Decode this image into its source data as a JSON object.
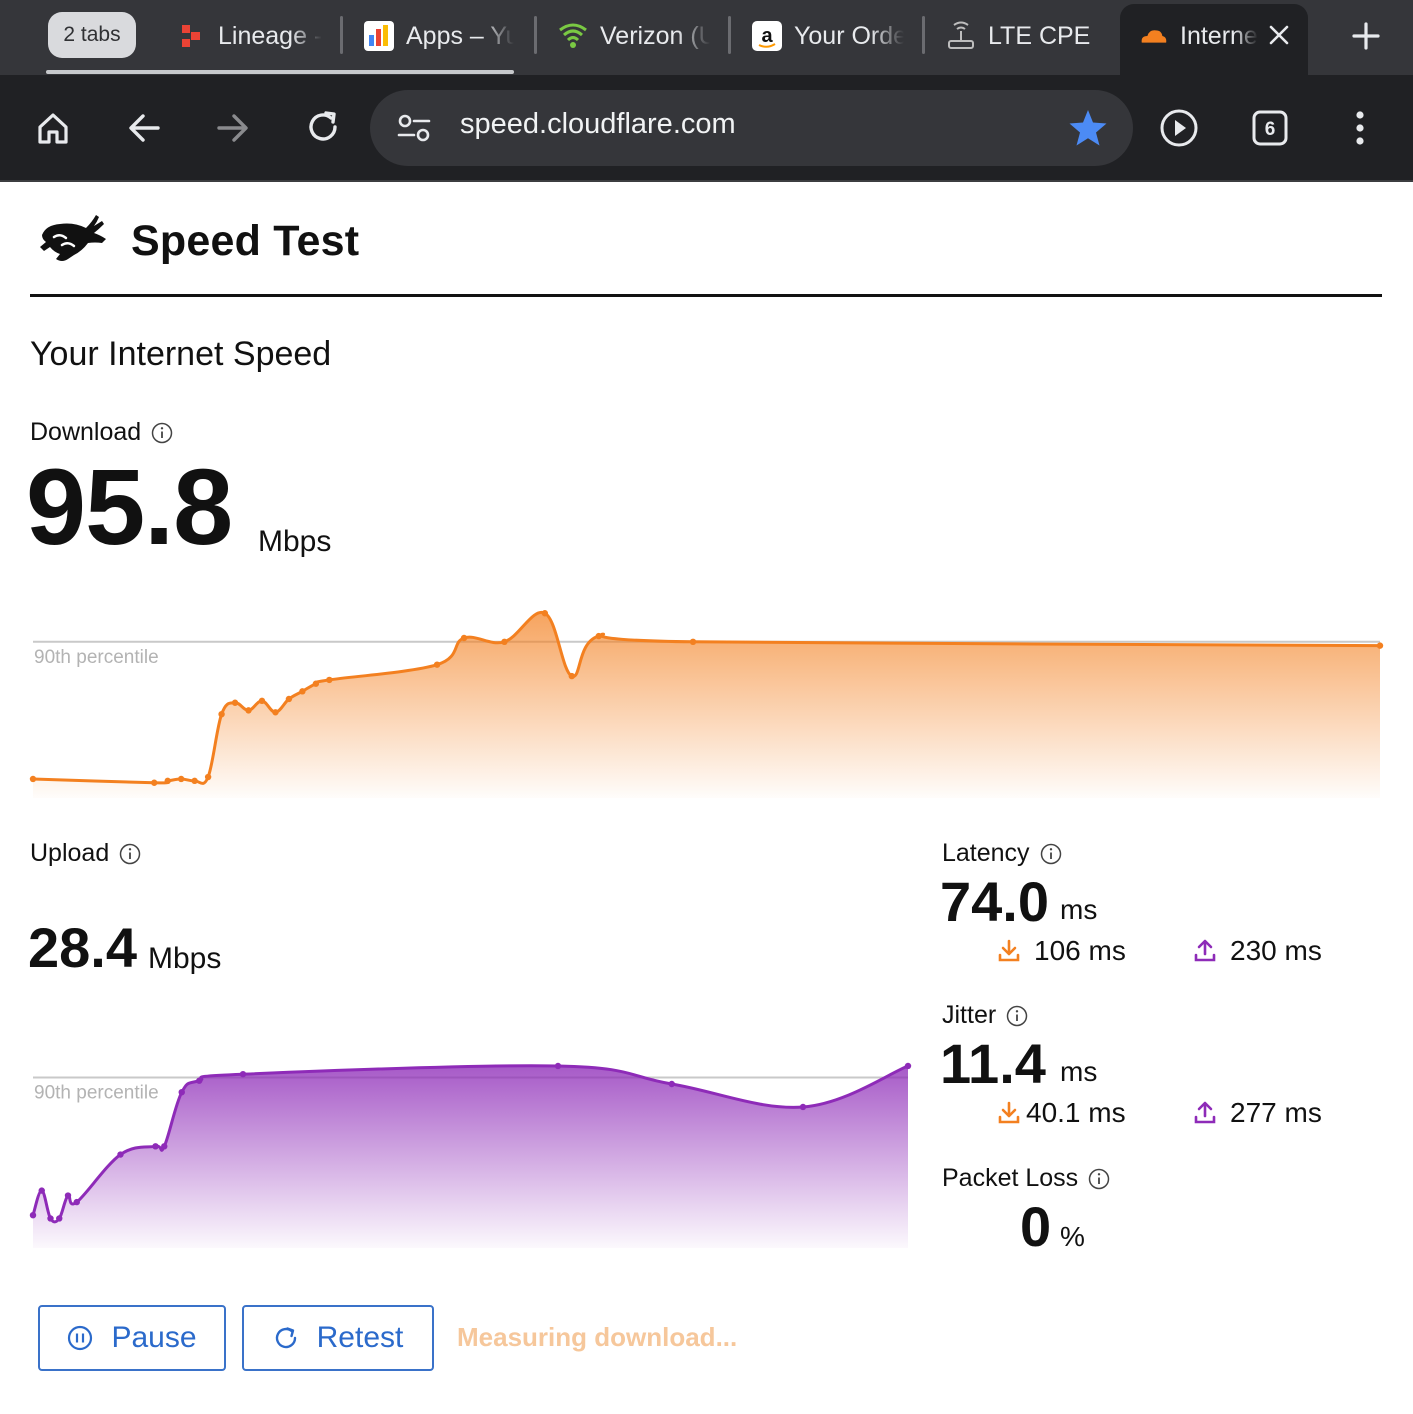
{
  "browser": {
    "tab_group_label": "2 tabs",
    "tabs": [
      {
        "title": "Lineage -",
        "icon": "lineage-icon"
      },
      {
        "title": "Apps – Yu",
        "icon": "apps-icon"
      },
      {
        "title": "Verizon (U",
        "icon": "wifi-icon"
      },
      {
        "title": "Your Orde",
        "icon": "amazon-icon"
      },
      {
        "title": "LTE CPE",
        "icon": "router-icon"
      },
      {
        "title": "Interne",
        "icon": "cloudflare-icon",
        "active": true
      }
    ],
    "url": "speed.cloudflare.com",
    "tab_count": "6",
    "colors": {
      "tabstrip": "#35363a",
      "toolbar": "#202124",
      "star": "#4c8bf5"
    }
  },
  "page": {
    "title": "Speed Test",
    "section_title": "Your Internet Speed",
    "download": {
      "label": "Download",
      "value": "95.8",
      "unit": "Mbps"
    },
    "upload": {
      "label": "Upload",
      "value": "28.4",
      "unit": "Mbps"
    },
    "latency": {
      "label": "Latency",
      "value": "74.0",
      "unit": "ms",
      "download": "106 ms",
      "upload": "230 ms"
    },
    "jitter": {
      "label": "Jitter",
      "value": "11.4",
      "unit": "ms",
      "download": "40.1 ms",
      "upload": "277 ms"
    },
    "packet_loss": {
      "label": "Packet Loss",
      "value": "0",
      "unit": "%"
    },
    "buttons": {
      "pause": "Pause",
      "retest": "Retest"
    },
    "status": "Measuring download...",
    "percentile_label": "90th percentile",
    "colors": {
      "download": "#f38020",
      "upload": "#8e2bb8",
      "button": "#2b6acb",
      "status": "#f6c79b"
    }
  },
  "chart_data": [
    {
      "type": "area",
      "name": "download",
      "percentile_label": "90th percentile",
      "x": [
        0,
        9,
        10,
        11,
        12,
        13,
        14,
        15,
        16,
        17,
        18,
        19,
        20,
        21,
        22,
        30,
        32,
        35,
        38,
        40,
        42,
        49,
        100
      ],
      "y": [
        10,
        8,
        9,
        10,
        9,
        11,
        44,
        50,
        46,
        51,
        45,
        52,
        56,
        60,
        62,
        70,
        84,
        82,
        97,
        64,
        85,
        82,
        80
      ],
      "ylim": [
        0,
        105
      ],
      "reference_line": 82
    },
    {
      "type": "area",
      "name": "upload",
      "percentile_label": "90th percentile",
      "x": [
        0,
        1,
        2,
        3,
        4,
        5,
        10,
        14,
        15,
        17,
        19,
        24,
        60,
        73,
        88,
        100
      ],
      "y": [
        20,
        35,
        18,
        18,
        32,
        28,
        57,
        62,
        62,
        95,
        102,
        106,
        111,
        100,
        86,
        111
      ],
      "ylim": [
        0,
        125
      ],
      "reference_line": 104
    }
  ]
}
